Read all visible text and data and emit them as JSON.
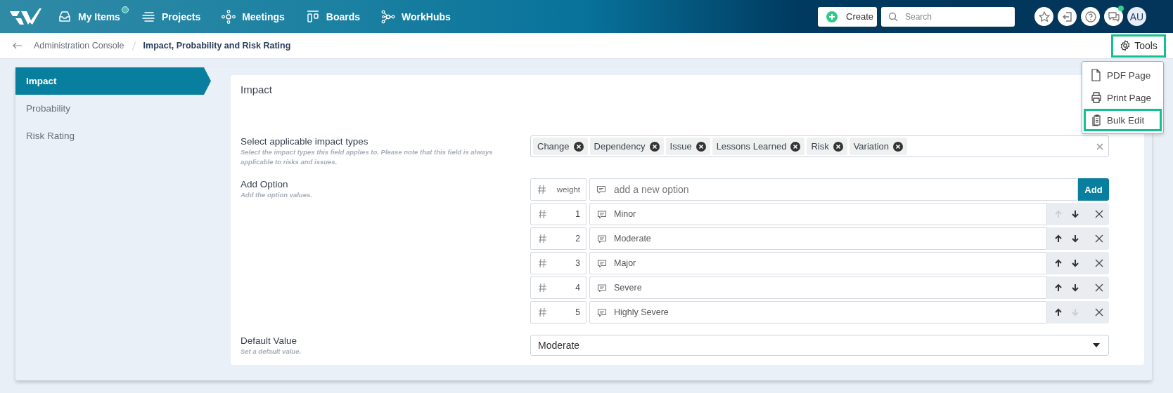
{
  "nav": {
    "items": [
      {
        "kind": "inbox",
        "label": "My Items",
        "badge": true
      },
      {
        "kind": "lines",
        "label": "Projects",
        "badge": false
      },
      {
        "kind": "network",
        "label": "Meetings",
        "badge": false
      },
      {
        "kind": "boards",
        "label": "Boards",
        "badge": false
      },
      {
        "kind": "nodes",
        "label": "WorkHubs",
        "badge": false
      }
    ]
  },
  "create_button": "Create",
  "search": {
    "placeholder": "Search"
  },
  "header_icons": [
    {
      "kind": "star",
      "badge": false
    },
    {
      "kind": "exit",
      "badge": false
    },
    {
      "kind": "help",
      "badge": false
    },
    {
      "kind": "chat",
      "badge": true
    }
  ],
  "avatar": "AU",
  "breadcrumb": [
    {
      "label": "Administration Console",
      "current": false
    },
    {
      "label": "Impact, Probability and Risk Rating",
      "current": true
    }
  ],
  "tools": {
    "label": "Tools",
    "highlighted": true,
    "menu": [
      {
        "kind": "pdf",
        "label": "PDF Page",
        "highlighted": false
      },
      {
        "kind": "print",
        "label": "Print Page",
        "highlighted": false
      },
      {
        "kind": "bulk",
        "label": "Bulk Edit",
        "highlighted": true
      }
    ]
  },
  "sidebar": {
    "items": [
      {
        "label": "Impact",
        "selected": true
      },
      {
        "label": "Probability",
        "selected": false
      },
      {
        "label": "Risk Rating",
        "selected": false
      }
    ]
  },
  "card": {
    "title": "Impact",
    "impact_types": {
      "label": "Select applicable impact types",
      "hint": "Select the impact types this field applies to. Please note that this field is always applicable to risks and issues.",
      "tags": [
        "Change",
        "Dependency",
        "Issue",
        "Lessons Learned",
        "Risk",
        "Variation"
      ]
    },
    "add_option": {
      "label": "Add Option",
      "hint": "Add the option values.",
      "weight_placeholder": "weight",
      "placeholder": "add a new option",
      "button": "Add"
    },
    "options": [
      {
        "weight": "1",
        "text": "Minor",
        "up_disabled": true,
        "down_disabled": false
      },
      {
        "weight": "2",
        "text": "Moderate",
        "up_disabled": false,
        "down_disabled": false
      },
      {
        "weight": "3",
        "text": "Major",
        "up_disabled": false,
        "down_disabled": false
      },
      {
        "weight": "4",
        "text": "Severe",
        "up_disabled": false,
        "down_disabled": false
      },
      {
        "weight": "5",
        "text": "Highly Severe",
        "up_disabled": false,
        "down_disabled": true
      }
    ],
    "default_value": {
      "label": "Default Value",
      "hint": "Set a default value.",
      "value": "Moderate"
    }
  }
}
